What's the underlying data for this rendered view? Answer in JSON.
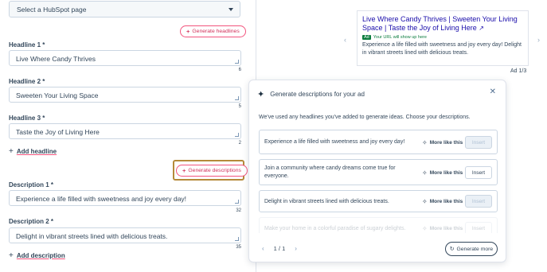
{
  "editor": {
    "page_select": {
      "value": "Select a HubSpot page",
      "icon": "chevron-down-icon"
    },
    "generate_headlines_label": "Generate headlines",
    "headlines": [
      {
        "label": "Headline 1 *",
        "value": "Live Where Candy Thrives",
        "count": "6"
      },
      {
        "label": "Headline 2 *",
        "value": "Sweeten Your Living Space",
        "count": "5"
      },
      {
        "label": "Headline 3 *",
        "value": "Taste the Joy of Living Here",
        "count": "2"
      }
    ],
    "add_headline_label": "Add headline",
    "generate_descriptions_label": "Generate descriptions",
    "descriptions": [
      {
        "label": "Description 1 *",
        "value": "Experience a life filled with sweetness and joy every day!",
        "count": "32"
      },
      {
        "label": "Description 2 *",
        "value": "Delight in vibrant streets lined with delicious treats.",
        "count": "35"
      }
    ],
    "add_description_label": "Add description"
  },
  "preview": {
    "ad_title": "Live Where Candy Thrives | Sweeten Your Living Space | Taste the Joy of Living Here",
    "ad_badge": "Ad",
    "ad_url_text": "Your URL will show up here",
    "ad_description": "Experience a life filled with sweetness and joy every day! Delight in vibrant streets lined with delicious treats.",
    "ad_position": "Ad 1/3",
    "prev_icon": "chevron-left-icon",
    "next_icon": "chevron-right-icon"
  },
  "modal": {
    "title": "Generate descriptions for your ad",
    "intro": "We've used any headlines you've added to generate ideas. Choose your descriptions.",
    "more_like_this_label": "More like this",
    "insert_label": "Insert",
    "items": [
      {
        "text": "Experience a life filled with sweetness and joy every day!",
        "insert_state": "disabled"
      },
      {
        "text": "Join a community where candy dreams come true for everyone.",
        "insert_state": "active"
      },
      {
        "text": "Delight in vibrant streets lined with delicious treats.",
        "insert_state": "disabled"
      },
      {
        "text": "Make your home in a colorful paradise of sugary delights.",
        "insert_state": "active"
      }
    ],
    "pagination": "1 / 1",
    "generate_more_label": "Generate more"
  },
  "colors": {
    "accent_pink": "#f2547d",
    "text_dark": "#33475b",
    "highlight_border": "#b58a3a",
    "ad_link": "#1a0dab",
    "ad_green": "#0b7c3e"
  }
}
